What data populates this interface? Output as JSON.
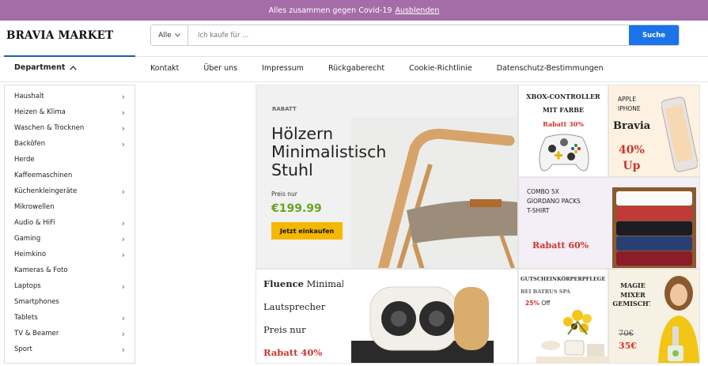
{
  "banner": {
    "text": "Alles zusammen gegen Covid-19",
    "link": "Ausblenden"
  },
  "logo": "BRAVIA MARKET",
  "search": {
    "category": "Alle",
    "placeholder": "Ich kaufe für ...",
    "button": "Suche"
  },
  "department": {
    "label": "Department"
  },
  "nav": [
    "Kontakt",
    "Über uns",
    "Impressum",
    "Rückgaberecht",
    "Cookie-Richtlinie",
    "Datenschutz-Bestimmungen"
  ],
  "sidebar": [
    {
      "label": "Haushalt",
      "arrow": true
    },
    {
      "label": "Heizen & Klima",
      "arrow": true
    },
    {
      "label": "Waschen & Trocknen",
      "arrow": true
    },
    {
      "label": "Backöfen",
      "arrow": true
    },
    {
      "label": "Herde",
      "arrow": false
    },
    {
      "label": "Kaffeemaschinen",
      "arrow": false
    },
    {
      "label": "Küchenkleingeräte",
      "arrow": true
    },
    {
      "label": "Mikrowellen",
      "arrow": false
    },
    {
      "label": "Audio & HiFi",
      "arrow": true
    },
    {
      "label": "Gaming",
      "arrow": true
    },
    {
      "label": "Heimkino",
      "arrow": true
    },
    {
      "label": "Kameras & Foto",
      "arrow": false
    },
    {
      "label": "Laptops",
      "arrow": true
    },
    {
      "label": "Smartphones",
      "arrow": false
    },
    {
      "label": "Tablets",
      "arrow": true
    },
    {
      "label": "TV & Beamer",
      "arrow": true
    },
    {
      "label": "Sport",
      "arrow": true
    }
  ],
  "hero": {
    "tag": "RABATT",
    "title_lines": [
      "Hölzern",
      "Minimalistisch",
      "Stuhl"
    ],
    "price_label": "Preis nur",
    "price": "€199.99",
    "button": "Jetzt einkaufen"
  },
  "xbox": {
    "line1": "XBOX-CONTROLLER",
    "line2": "MIT FARBE",
    "discount": "Rabatt 30%"
  },
  "apple": {
    "line1": "APPLE",
    "line2": "IPHONE",
    "brand": "Bravia",
    "pct": "40%",
    "up": "Up"
  },
  "combo": {
    "line1": "COMBO 5X",
    "line2": "GIORDANO PACKS",
    "line3": "T-SHIRT",
    "discount": "Rabatt 60%"
  },
  "fluence": {
    "brand": "Fluence",
    "line1": "Minimal",
    "line2": "Lautsprecher",
    "line3": "Preis nur",
    "discount": "Rabatt 40%"
  },
  "gutschein": {
    "line1": "GUTSCHEINKÖRPERPFLEGE",
    "line2": "BEI BATRUS SPA",
    "pct": "25%",
    "off": "Off"
  },
  "magie": {
    "line1": "MAGIE",
    "line2": "MIXER",
    "line3": "GEMISCHT",
    "old_price": "70€",
    "new_price": "35€"
  },
  "colors": {
    "banner": "#a56da8",
    "primary": "#1a73e8",
    "price_green": "#68a51f",
    "discount_red": "#d0342c",
    "button_yellow": "#f5b800"
  }
}
